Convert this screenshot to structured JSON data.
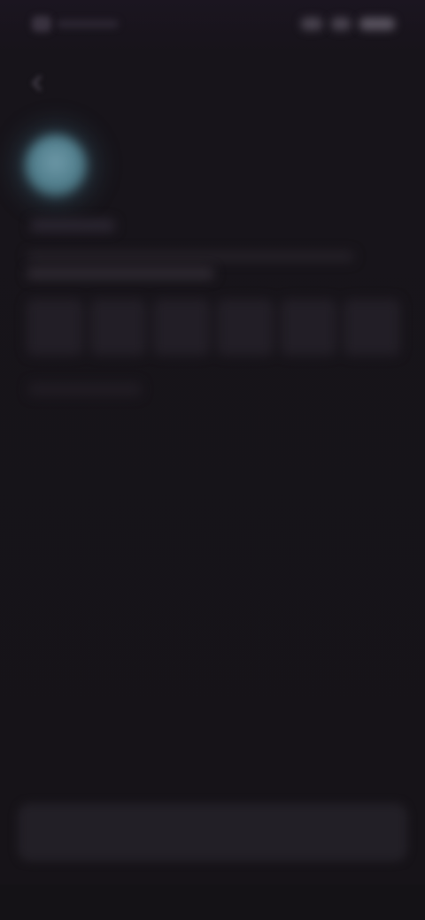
{
  "status_bar": {
    "left_icon": "app-icon",
    "right_icons": [
      "signal-icon",
      "wifi-icon",
      "battery-icon"
    ]
  },
  "header": {
    "back_icon": "back-arrow-icon"
  },
  "profile": {
    "avatar_color": "#5d8a99"
  },
  "form": {
    "code_cells": [
      "",
      "",
      "",
      "",
      "",
      ""
    ]
  },
  "footer": {
    "primary_button_label": ""
  },
  "colors": {
    "background": "#17141a",
    "surface": "#221e26",
    "accent": "#5d8a99"
  }
}
